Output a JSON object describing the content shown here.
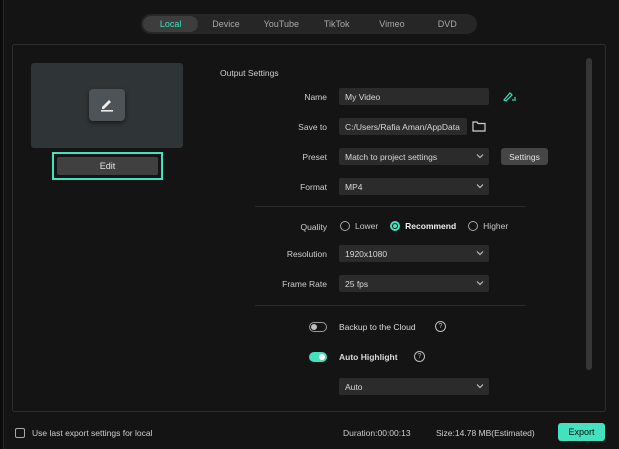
{
  "tabs": [
    {
      "label": "Local",
      "active": true
    },
    {
      "label": "Device",
      "active": false
    },
    {
      "label": "YouTube",
      "active": false
    },
    {
      "label": "TikTok",
      "active": false
    },
    {
      "label": "Vimeo",
      "active": false
    },
    {
      "label": "DVD",
      "active": false
    }
  ],
  "preview": {
    "edit_label": "Edit"
  },
  "output_settings": {
    "title": "Output Settings",
    "name_label": "Name",
    "name_value": "My Video",
    "save_to_label": "Save to",
    "save_to_value": "C:/Users/Rafia Aman/AppData",
    "preset_label": "Preset",
    "preset_value": "Match to project settings",
    "settings_button": "Settings",
    "format_label": "Format",
    "format_value": "MP4",
    "quality_label": "Quality",
    "quality_options": [
      "Lower",
      "Recommend",
      "Higher"
    ],
    "quality_selected": "Recommend",
    "resolution_label": "Resolution",
    "resolution_value": "1920x1080",
    "frame_rate_label": "Frame Rate",
    "frame_rate_value": "25 fps",
    "backup_label": "Backup to the Cloud",
    "backup_on": false,
    "auto_highlight_label": "Auto Highlight",
    "auto_highlight_on": true,
    "auto_highlight_value": "Auto",
    "help_glyph": "?"
  },
  "footer": {
    "use_last_label": "Use last export settings for local",
    "use_last_checked": false,
    "duration": "Duration:00:00:13",
    "size": "Size:14.78 MB(Estimated)",
    "export_label": "Export"
  },
  "colors": {
    "accent": "#43e1bd",
    "background": "#141414",
    "field": "#2b2b2b"
  }
}
